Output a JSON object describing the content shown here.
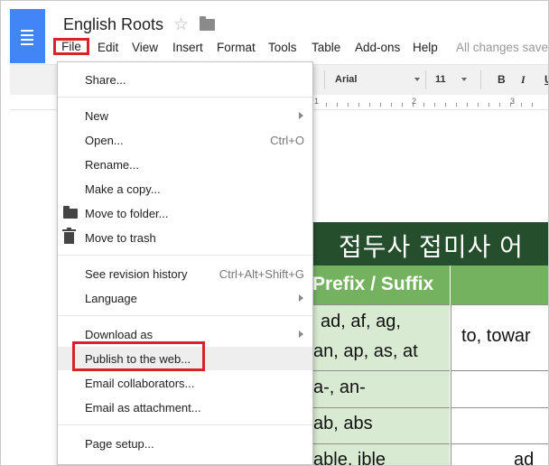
{
  "app": {
    "doc_title": "English Roots",
    "icons": {
      "logo": "docs-logo-icon",
      "star": "star-icon",
      "folder": "folder-icon"
    }
  },
  "menubar": {
    "items": [
      "File",
      "Edit",
      "View",
      "Insert",
      "Format",
      "Tools",
      "Table",
      "Add-ons",
      "Help"
    ],
    "status": "All changes saved"
  },
  "toolbar": {
    "font": "Arial",
    "font_size": "11",
    "bold": "B",
    "italic": "I",
    "underline": "U"
  },
  "ruler": {
    "labels": [
      "1",
      "2",
      "3"
    ]
  },
  "table": {
    "header": "접두사 접미사 어",
    "subheader_left": "Prefix / Suffix",
    "rows": [
      {
        "left_line1": "ad, af, ag,",
        "left_line2": "an, ap, as, at",
        "right": "to, towar"
      },
      {
        "left_line1": "a-, an-",
        "left_line2": "",
        "right": ""
      },
      {
        "left_line1": "ab, abs",
        "left_line2": "",
        "right": ""
      },
      {
        "left_line1": "able, ible",
        "left_line2": "",
        "right": "ad"
      }
    ]
  },
  "file_menu": {
    "items": [
      {
        "label": "Share...",
        "shortcut": "",
        "submenu": false
      },
      {
        "label": "New",
        "shortcut": "",
        "submenu": true
      },
      {
        "label": "Open...",
        "shortcut": "Ctrl+O",
        "submenu": false
      },
      {
        "label": "Rename...",
        "shortcut": "",
        "submenu": false
      },
      {
        "label": "Make a copy...",
        "shortcut": "",
        "submenu": false
      },
      {
        "label": "Move to folder...",
        "shortcut": "",
        "submenu": false,
        "icon": "folder-icon"
      },
      {
        "label": "Move to trash",
        "shortcut": "",
        "submenu": false,
        "icon": "trash-icon"
      },
      {
        "label": "See revision history",
        "shortcut": "Ctrl+Alt+Shift+G",
        "submenu": false
      },
      {
        "label": "Language",
        "shortcut": "",
        "submenu": true
      },
      {
        "label": "Download as",
        "shortcut": "",
        "submenu": true
      },
      {
        "label": "Publish to the web...",
        "shortcut": "",
        "submenu": false,
        "highlighted": true
      },
      {
        "label": "Email collaborators...",
        "shortcut": "",
        "submenu": false
      },
      {
        "label": "Email as attachment...",
        "shortcut": "",
        "submenu": false
      },
      {
        "label": "Page setup...",
        "shortcut": "",
        "submenu": false
      }
    ]
  },
  "colors": {
    "annotation_red": "#d8232a",
    "docs_blue": "#4285f4",
    "table_header_green": "#244e2c",
    "table_sub_green": "#74b25f",
    "table_cell_green": "#d9ead3"
  }
}
